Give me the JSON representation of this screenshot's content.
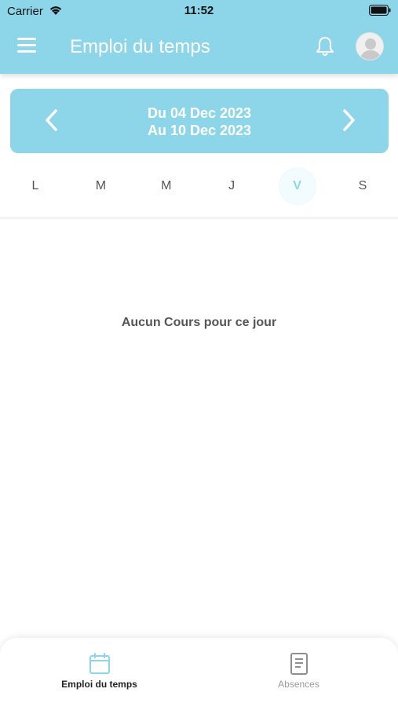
{
  "status_bar": {
    "carrier": "Carrier",
    "time": "11:52"
  },
  "header": {
    "title": "Emploi du temps",
    "menu_icon": "hamburger-menu-icon",
    "notification_icon": "bell-icon",
    "avatar_icon": "user-avatar-icon"
  },
  "week": {
    "from": "Du 04 Dec 2023",
    "to": "Au 10 Dec 2023"
  },
  "days": [
    {
      "label": "L"
    },
    {
      "label": "M"
    },
    {
      "label": "M"
    },
    {
      "label": "J"
    },
    {
      "label": "V",
      "selected": true
    },
    {
      "label": "S"
    }
  ],
  "empty_message": "Aucun Cours pour ce jour",
  "tabs": [
    {
      "label": "Emploi du temps",
      "icon": "calendar-icon",
      "active": true
    },
    {
      "label": "Absences",
      "icon": "document-icon",
      "active": false
    }
  ],
  "colors": {
    "accent": "#8dd6ea",
    "text": "#555555",
    "inactive": "#9a9a9a"
  }
}
